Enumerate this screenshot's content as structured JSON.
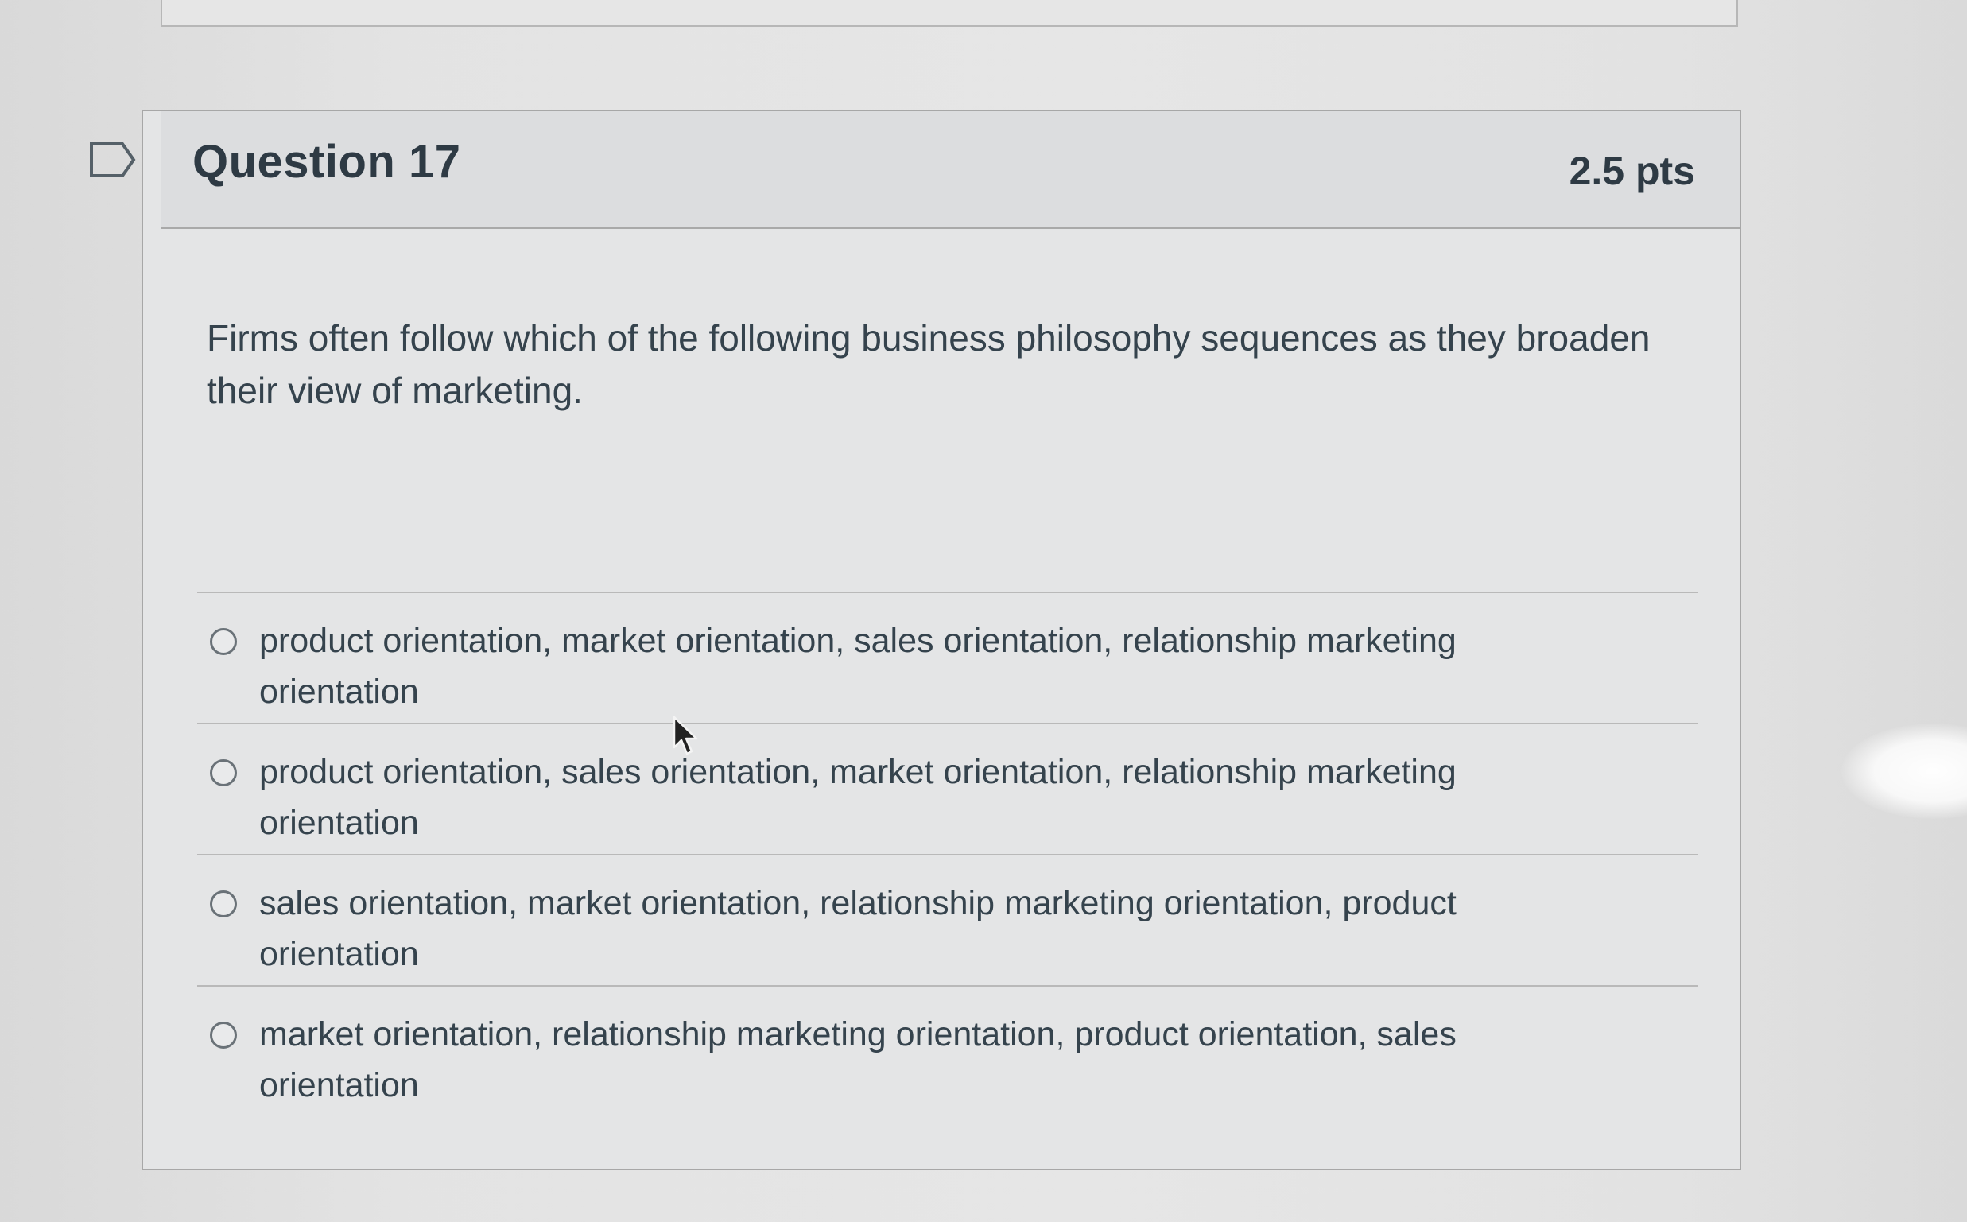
{
  "question": {
    "title": "Question 17",
    "points": "2.5 pts",
    "text": "Firms often follow which of the following business philosophy sequences as they broaden their view of marketing.",
    "flag_icon": "flag-outline-icon",
    "answers": [
      {
        "label": "product orientation, market orientation, sales orientation, relationship marketing orientation",
        "selected": false
      },
      {
        "label": "product orientation, sales orientation, market orientation, relationship marketing orientation",
        "selected": false
      },
      {
        "label": "sales orientation, market orientation, relationship marketing orientation, product orientation",
        "selected": false
      },
      {
        "label": "market orientation, relationship marketing orientation, product orientation, sales orientation",
        "selected": false
      }
    ]
  },
  "colors": {
    "text": "#2d3b45",
    "border": "#a7a7a7",
    "header_bg": "#dcdddf",
    "card_bg": "#e4e5e6"
  }
}
